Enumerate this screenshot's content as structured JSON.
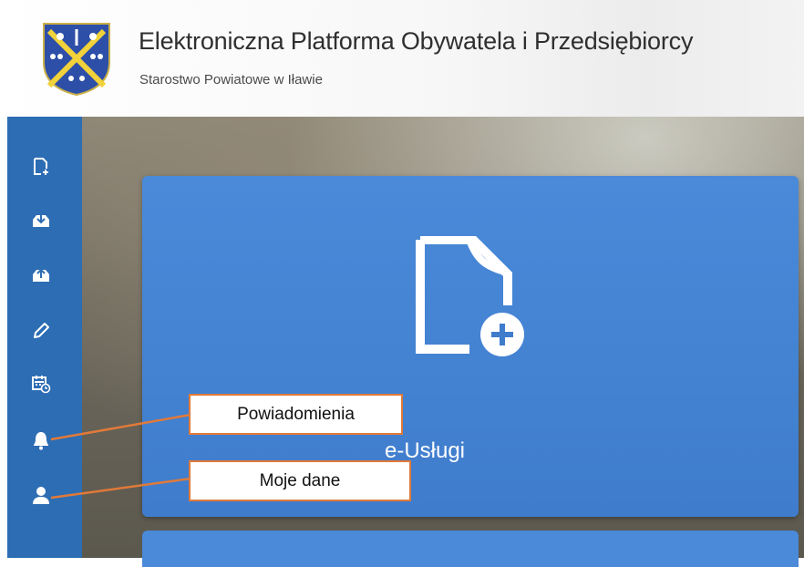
{
  "header": {
    "title": "Elektroniczna Platforma Obywatela i Przedsiębiorcy",
    "subtitle": "Starostwo Powiatowe w Iławie",
    "logo": "coat-of-arms"
  },
  "sidebar": {
    "items": [
      {
        "icon": "new-document-icon"
      },
      {
        "icon": "inbox-download-icon"
      },
      {
        "icon": "outbox-upload-icon"
      },
      {
        "icon": "pencil-icon"
      },
      {
        "icon": "calendar-clock-icon"
      },
      {
        "icon": "bell-icon"
      },
      {
        "icon": "user-icon"
      }
    ]
  },
  "main": {
    "tile": {
      "label": "e-Usługi",
      "icon": "new-document-plus-icon"
    }
  },
  "callouts": {
    "notifications": "Powiadomienia",
    "my_data": "Moje dane"
  },
  "colors": {
    "sidebar": "#2d6db4",
    "tile": "#4a8ad9",
    "callout_border": "#e07a3a"
  }
}
